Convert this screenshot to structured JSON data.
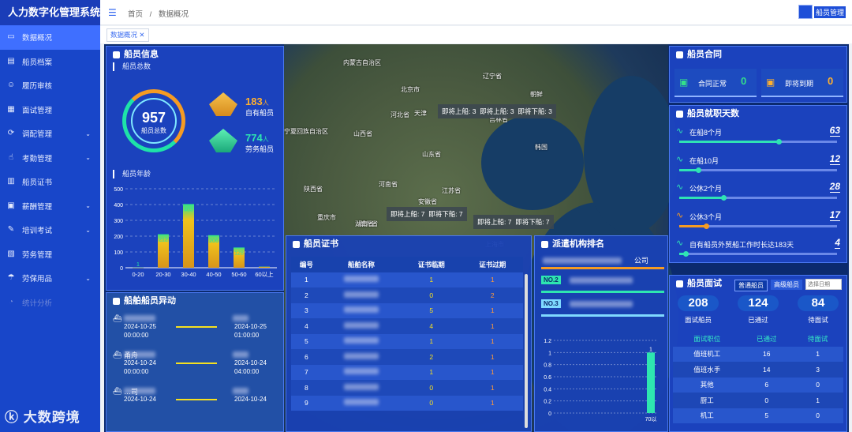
{
  "app_title": "人力数字化管理系统",
  "sidebar": {
    "items": [
      {
        "label": "数据概况",
        "icon": "monitor-icon",
        "expand": false
      },
      {
        "label": "船员档案",
        "icon": "folder-icon",
        "expand": false
      },
      {
        "label": "履历审核",
        "icon": "user-icon",
        "expand": false
      },
      {
        "label": "面试管理",
        "icon": "form-icon",
        "expand": false
      },
      {
        "label": "调配管理",
        "icon": "swap-icon",
        "expand": true
      },
      {
        "label": "考勤管理",
        "icon": "fingerprint-icon",
        "expand": true
      },
      {
        "label": "船员证书",
        "icon": "certificate-icon",
        "expand": false
      },
      {
        "label": "薪酬管理",
        "icon": "money-icon",
        "expand": true
      },
      {
        "label": "培训考试",
        "icon": "exam-icon",
        "expand": true
      },
      {
        "label": "劳务管理",
        "icon": "labor-icon",
        "expand": false
      },
      {
        "label": "劳保用品",
        "icon": "umbrella-icon",
        "expand": true
      },
      {
        "label": "统计分析",
        "icon": "chart-icon",
        "expand": false
      }
    ]
  },
  "topbar": {
    "breadcrumb": [
      "首页",
      "/",
      "数据概况"
    ],
    "user_name": "船员管理"
  },
  "tabs": [
    {
      "label": "数据概况"
    }
  ],
  "crew_info": {
    "title": "船员信息",
    "total_label": "船员总数",
    "total": "957",
    "own_count": "183",
    "own_unit": "人",
    "own_label": "自有船员",
    "labor_count": "774",
    "labor_unit": "人",
    "labor_label": "劳务船员",
    "age_label": "船员年龄"
  },
  "chart_data": {
    "type": "bar",
    "categories": [
      "0-20",
      "20-30",
      "30-40",
      "40-50",
      "50-60",
      "60以上"
    ],
    "values": [
      1,
      212,
      403,
      206,
      128,
      7
    ],
    "ylim": [
      0,
      500
    ],
    "yticks": [
      0,
      100,
      200,
      300,
      400,
      500
    ],
    "data_labels": [
      "1",
      "212",
      "403",
      "206",
      "128",
      ""
    ],
    "grid": true
  },
  "vessel_change": {
    "title": "船舶船员异动",
    "rows": [
      {
        "left_date": "2024-10-25",
        "left_time": "00:00:00",
        "right_date": "2024-10-25",
        "right_time": "01:00:00",
        "left_name": "",
        "right_name": ""
      },
      {
        "left_date": "2024-10-24",
        "left_time": "00:00:00",
        "right_date": "2024-10-24",
        "right_time": "04:00:00",
        "left_name": "甬舟",
        "right_name": ""
      },
      {
        "left_date": "2024-10-24",
        "left_time": "",
        "right_date": "2024-10-24",
        "right_time": "",
        "left_name": "…司",
        "right_name": ""
      }
    ]
  },
  "map": {
    "labels": [
      "内蒙古自治区",
      "北京市",
      "天津",
      "河北省",
      "辽宁省",
      "吉林省",
      "朝鲜",
      "韩国",
      "山西省",
      "山东省",
      "宁夏回族自治区",
      "陕西省",
      "河南省",
      "安徽省",
      "江苏省",
      "湖北省",
      "重庆市",
      "湖南省",
      "上海市"
    ],
    "boxes": [
      {
        "a": "即将上船: 3",
        "b": "即将上船: 3",
        "c": "即将下船: 3"
      },
      {
        "a": "即将上船: 7",
        "b": "即将下船: 7",
        "c": ""
      },
      {
        "a": "即将上船: 7",
        "b": "即将下船: 7",
        "c": ""
      }
    ]
  },
  "cert": {
    "title": "船员证书",
    "headers": [
      "编号",
      "船舶名称",
      "证书临期",
      "证书过期"
    ],
    "rows": [
      {
        "no": "1",
        "exp_soon": "1",
        "expired": "1"
      },
      {
        "no": "2",
        "exp_soon": "0",
        "expired": "2"
      },
      {
        "no": "3",
        "exp_soon": "5",
        "expired": "1"
      },
      {
        "no": "4",
        "exp_soon": "4",
        "expired": "1"
      },
      {
        "no": "5",
        "exp_soon": "1",
        "expired": "1"
      },
      {
        "no": "6",
        "exp_soon": "2",
        "expired": "1"
      },
      {
        "no": "7",
        "exp_soon": "1",
        "expired": "1"
      },
      {
        "no": "8",
        "exp_soon": "0",
        "expired": "1"
      },
      {
        "no": "9",
        "exp_soon": "0",
        "expired": "1"
      }
    ]
  },
  "agency": {
    "title": "派遣机构排名",
    "row1_suffix": "公司",
    "no2": "NO.2",
    "no3": "NO.3",
    "chart_yticks": [
      "1.2",
      "1",
      "0.8",
      "0.6",
      "0.4",
      "0.2",
      "0"
    ],
    "chart_xlabel": "70以",
    "chart_value_label": "1",
    "chart_value": 1
  },
  "contract": {
    "title": "船员合同",
    "normal_label": "合同正常",
    "normal_value": "0",
    "expiring_label": "即将到期",
    "expiring_value": "0"
  },
  "service_days": {
    "title": "船员就职天数",
    "rows": [
      {
        "label": "在船8个月",
        "value": "63",
        "level": 0.63,
        "color": "#2fe3b4"
      },
      {
        "label": "在船10月",
        "value": "12",
        "level": 0.12,
        "color": "#2fe3b4"
      },
      {
        "label": "公休2个月",
        "value": "28",
        "level": 0.28,
        "color": "#2fe3b4"
      },
      {
        "label": "公休3个月",
        "value": "17",
        "level": 0.17,
        "color": "#f59b23"
      },
      {
        "label": "自有船员外贸船工作时长达183天",
        "value": "4",
        "level": 0.04,
        "color": "#2fe3b4"
      }
    ]
  },
  "interview": {
    "title": "船员面试",
    "btn_normal": "普通船员",
    "btn_senior": "高级船员",
    "date_placeholder": "选择日期",
    "total": "208",
    "total_label": "面试船员",
    "passed": "124",
    "passed_label": "已通过",
    "pending": "84",
    "pending_label": "待面试",
    "headers": [
      "面试职位",
      "已通过",
      "待面试"
    ],
    "rows": [
      {
        "pos": "值班机工",
        "passed": "16",
        "pending": "1"
      },
      {
        "pos": "值班水手",
        "passed": "14",
        "pending": "3"
      },
      {
        "pos": "其他",
        "passed": "6",
        "pending": "0"
      },
      {
        "pos": "厨工",
        "passed": "0",
        "pending": "1"
      },
      {
        "pos": "机工",
        "passed": "5",
        "pending": "0"
      }
    ]
  },
  "watermark": "大数跨境",
  "colors": {
    "accent": "#3f6fff",
    "orange": "#f59b23",
    "green": "#2fe3b4"
  }
}
